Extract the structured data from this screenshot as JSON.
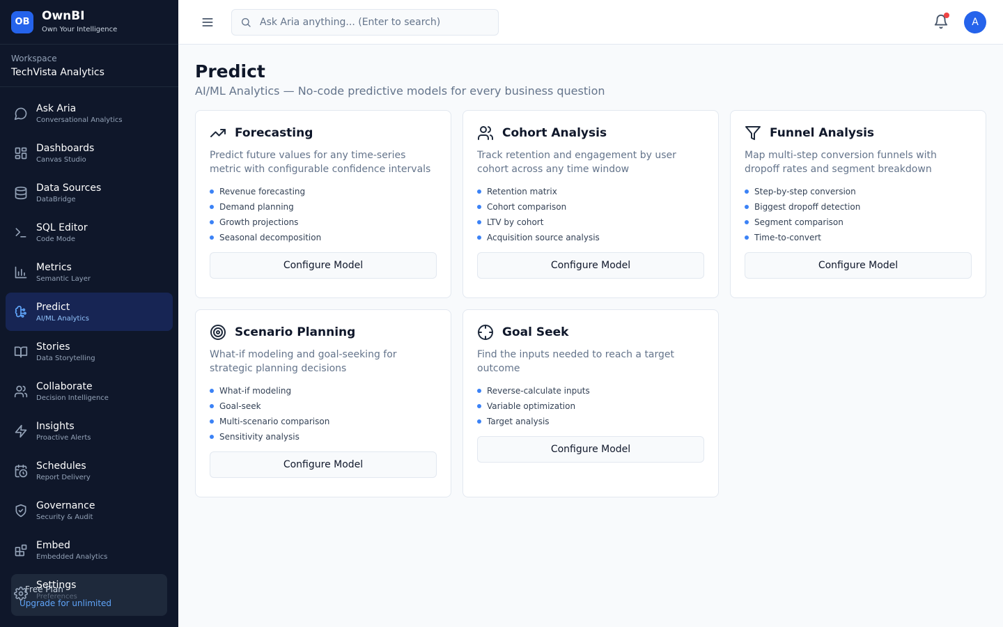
{
  "brand": {
    "logo": "OB",
    "name": "OwnBI",
    "tagline": "Own Your Intelligence"
  },
  "workspace": {
    "label": "Workspace",
    "name": "TechVista Analytics"
  },
  "nav": [
    {
      "label": "Ask Aria",
      "sub": "Conversational Analytics",
      "icon": "chat-icon"
    },
    {
      "label": "Dashboards",
      "sub": "Canvas Studio",
      "icon": "dashboard-icon"
    },
    {
      "label": "Data Sources",
      "sub": "DataBridge",
      "icon": "database-icon"
    },
    {
      "label": "SQL Editor",
      "sub": "Code Mode",
      "icon": "terminal-icon"
    },
    {
      "label": "Metrics",
      "sub": "Semantic Layer",
      "icon": "bar-chart-icon"
    },
    {
      "label": "Predict",
      "sub": "AI/ML Analytics",
      "icon": "brain-icon",
      "active": true
    },
    {
      "label": "Stories",
      "sub": "Data Storytelling",
      "icon": "book-icon"
    },
    {
      "label": "Collaborate",
      "sub": "Decision Intelligence",
      "icon": "users-icon"
    },
    {
      "label": "Insights",
      "sub": "Proactive Alerts",
      "icon": "lightning-icon"
    },
    {
      "label": "Schedules",
      "sub": "Report Delivery",
      "icon": "calendar-clock-icon"
    },
    {
      "label": "Governance",
      "sub": "Security & Audit",
      "icon": "shield-icon"
    },
    {
      "label": "Embed",
      "sub": "Embedded Analytics",
      "icon": "blocks-icon"
    }
  ],
  "settings": {
    "label": "Settings",
    "sub": "Preferences"
  },
  "plan": {
    "title": "Free Plan",
    "link": "Upgrade for unlimited"
  },
  "topbar": {
    "search_placeholder": "Ask Aria anything... (Enter to search)",
    "avatar_initial": "A"
  },
  "page": {
    "title": "Predict",
    "subtitle": "AI/ML Analytics — No-code predictive models for every business question"
  },
  "cards": [
    {
      "title": "Forecasting",
      "icon": "trending-up-icon",
      "desc": "Predict future values for any time-series metric with configurable confidence intervals",
      "features": [
        "Revenue forecasting",
        "Demand planning",
        "Growth projections",
        "Seasonal decomposition"
      ],
      "button": "Configure Model"
    },
    {
      "title": "Cohort Analysis",
      "icon": "users-icon",
      "desc": "Track retention and engagement by user cohort across any time window",
      "features": [
        "Retention matrix",
        "Cohort comparison",
        "LTV by cohort",
        "Acquisition source analysis"
      ],
      "button": "Configure Model"
    },
    {
      "title": "Funnel Analysis",
      "icon": "funnel-icon",
      "desc": "Map multi-step conversion funnels with dropoff rates and segment breakdown",
      "features": [
        "Step-by-step conversion",
        "Biggest dropoff detection",
        "Segment comparison",
        "Time-to-convert"
      ],
      "button": "Configure Model"
    },
    {
      "title": "Scenario Planning",
      "icon": "target-icon",
      "desc": "What-if modeling and goal-seeking for strategic planning decisions",
      "features": [
        "What-if modeling",
        "Goal-seek",
        "Multi-scenario comparison",
        "Sensitivity analysis"
      ],
      "button": "Configure Model"
    },
    {
      "title": "Goal Seek",
      "icon": "crosshair-icon",
      "desc": "Find the inputs needed to reach a target outcome",
      "features": [
        "Reverse-calculate inputs",
        "Variable optimization",
        "Target analysis"
      ],
      "button": "Configure Model"
    }
  ],
  "colors": {
    "sidebar_bg": "#0f172a",
    "accent": "#2563eb",
    "active_bg": "#172554",
    "notification": "#ef4444"
  }
}
